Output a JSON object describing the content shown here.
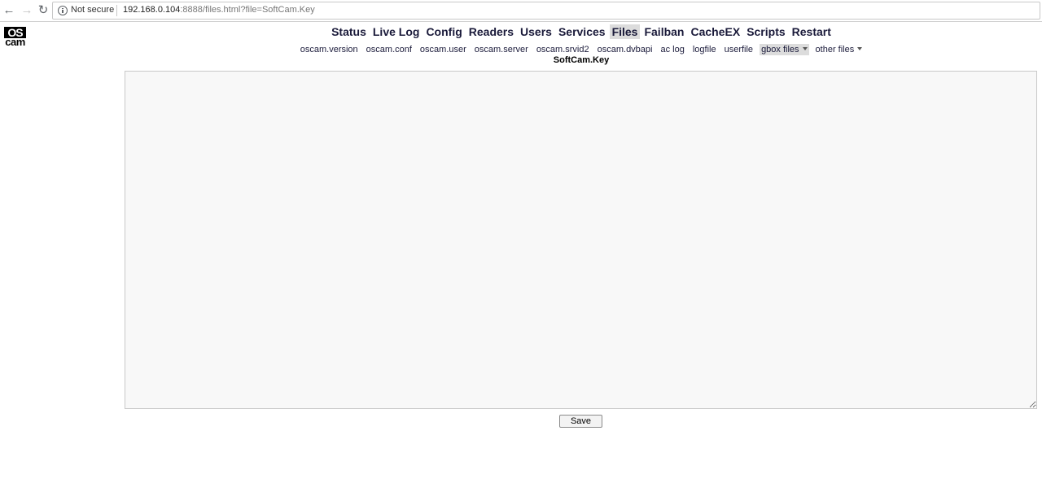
{
  "browser": {
    "security_label": "Not secure",
    "url_host": "192.168.0.104",
    "url_rest": ":8888/files.html?file=SoftCam.Key"
  },
  "logo": {
    "top": "OS",
    "bottom": "cam"
  },
  "main_menu": [
    "Status",
    "Live Log",
    "Config",
    "Readers",
    "Users",
    "Services",
    "Files",
    "Failban",
    "CacheEX",
    "Scripts",
    "Restart"
  ],
  "main_menu_active": "Files",
  "sub_menu": [
    "oscam.version",
    "oscam.conf",
    "oscam.user",
    "oscam.server",
    "oscam.srvid2",
    "oscam.dvbapi",
    "ac log",
    "logfile",
    "userfile"
  ],
  "sub_menu_dropdowns": {
    "gbox": "gbox files",
    "other": "other files"
  },
  "file_title": "SoftCam.Key",
  "editor_content": "",
  "save_label": "Save"
}
